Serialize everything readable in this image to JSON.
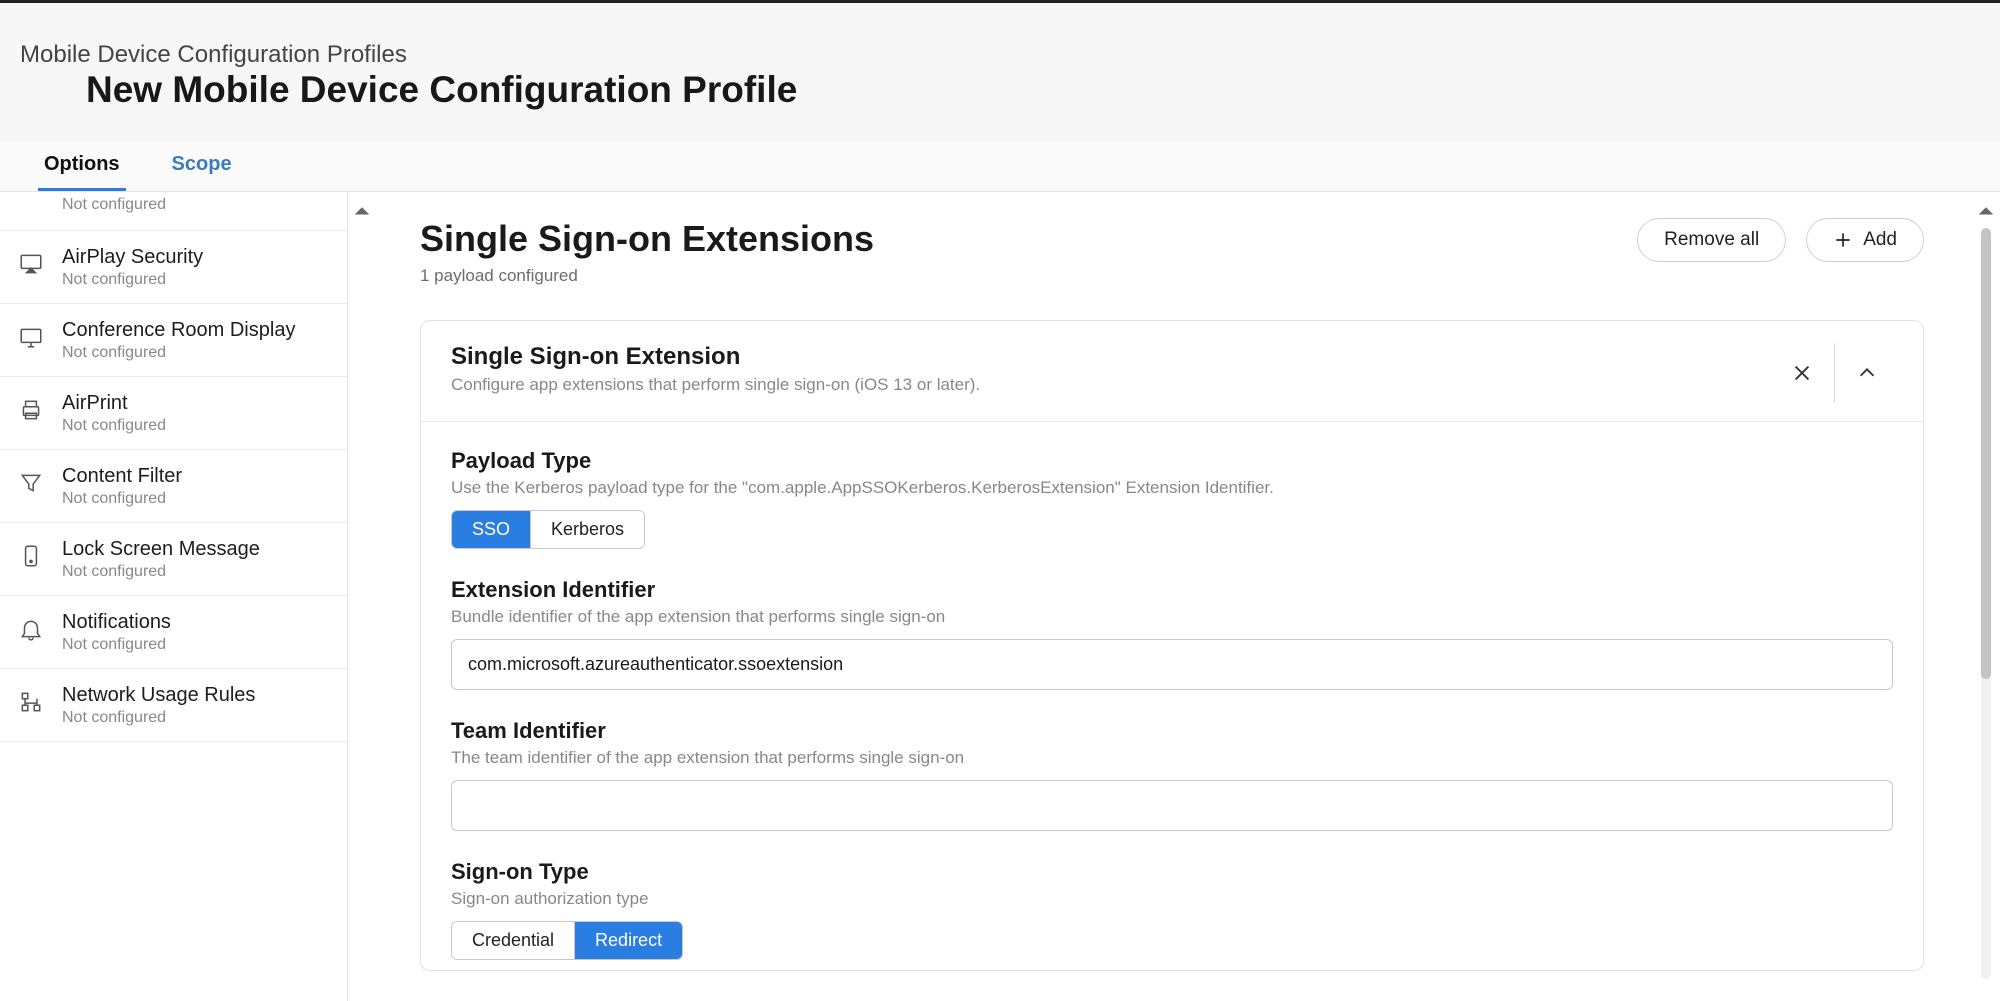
{
  "breadcrumb": "Mobile Device Configuration Profiles",
  "page_title": "New Mobile Device Configuration Profile",
  "tabs": {
    "options": "Options",
    "scope": "Scope"
  },
  "sidebar": {
    "not_configured": "Not configured",
    "items": [
      {
        "title": "AirPlay Security"
      },
      {
        "title": "Conference Room Display"
      },
      {
        "title": "AirPrint"
      },
      {
        "title": "Content Filter"
      },
      {
        "title": "Lock Screen Message"
      },
      {
        "title": "Notifications"
      },
      {
        "title": "Network Usage Rules"
      }
    ]
  },
  "section": {
    "title": "Single Sign-on Extensions",
    "sub": "1 payload configured",
    "remove_all": "Remove all",
    "add": "Add"
  },
  "card": {
    "title": "Single Sign-on Extension",
    "sub": "Configure app extensions that perform single sign-on (iOS 13 or later)."
  },
  "form": {
    "payload_type": {
      "title": "Payload Type",
      "help": "Use the Kerberos payload type for the \"com.apple.AppSSOKerberos.KerberosExtension\" Extension Identifier.",
      "sso": "SSO",
      "kerberos": "Kerberos"
    },
    "ext_id": {
      "title": "Extension Identifier",
      "help": "Bundle identifier of the app extension that performs single sign-on",
      "value": "com.microsoft.azureauthenticator.ssoextension"
    },
    "team_id": {
      "title": "Team Identifier",
      "help": "The team identifier of the app extension that performs single sign-on",
      "value": ""
    },
    "signon_type": {
      "title": "Sign-on Type",
      "help": "Sign-on authorization type",
      "credential": "Credential",
      "redirect": "Redirect"
    }
  }
}
